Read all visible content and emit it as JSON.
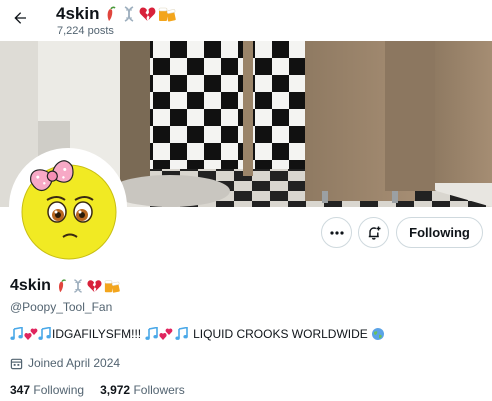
{
  "header": {
    "title": "4skin",
    "post_count": "7,224 posts"
  },
  "profile": {
    "display_name": "4skin",
    "handle": "@Poopy_Tool_Fan",
    "bio_text_1": "IDGAFILYSFM!!!",
    "bio_text_2": "LIQUID CROOKS WORLDWIDE",
    "joined": "Joined April 2024",
    "following_count": "347",
    "following_label": "Following",
    "followers_count": "3,972",
    "followers_label": "Followers"
  },
  "actions": {
    "follow_label": "Following"
  },
  "icons": {
    "back": "arrow-left-icon",
    "more": "more-dots-icon",
    "notify": "bell-plus-icon",
    "calendar": "calendar-icon",
    "globe": "globe-icon",
    "emoji_name": [
      "pepper-icon",
      "dna-icon",
      "broken-heart-icon",
      "beer-icon"
    ],
    "bio_emoji": [
      "music-notes-icon",
      "hearts-icon"
    ]
  },
  "colors": {
    "text": "#0f1419",
    "secondary": "#536471",
    "border": "#cfd9de",
    "avatar_face": "#f1ea23",
    "bow": "#f7a9c6"
  }
}
